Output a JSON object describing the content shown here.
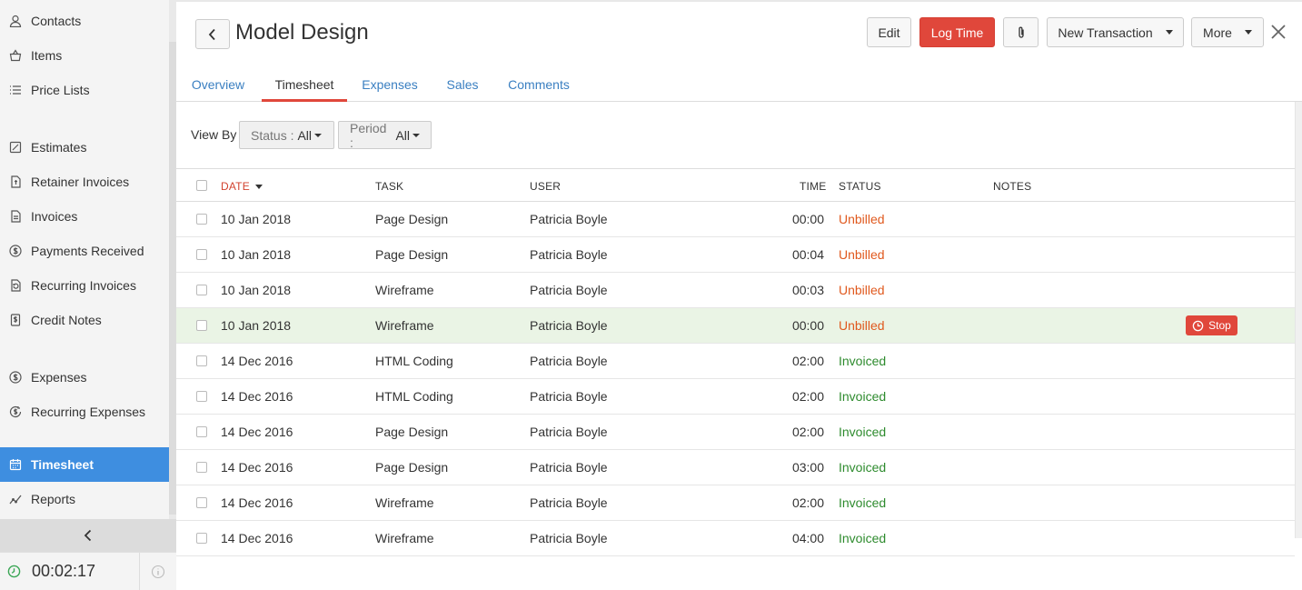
{
  "sidebar": {
    "items": [
      {
        "label": "Contacts",
        "icon": "contacts-icon"
      },
      {
        "label": "Items",
        "icon": "items-icon"
      },
      {
        "label": "Price Lists",
        "icon": "price-lists-icon"
      },
      {
        "label": "Estimates",
        "icon": "estimates-icon"
      },
      {
        "label": "Retainer Invoices",
        "icon": "retainer-invoices-icon"
      },
      {
        "label": "Invoices",
        "icon": "invoices-icon"
      },
      {
        "label": "Payments Received",
        "icon": "payments-received-icon"
      },
      {
        "label": "Recurring Invoices",
        "icon": "recurring-invoices-icon"
      },
      {
        "label": "Credit Notes",
        "icon": "credit-notes-icon"
      },
      {
        "label": "Expenses",
        "icon": "expenses-icon"
      },
      {
        "label": "Recurring Expenses",
        "icon": "recurring-expenses-icon"
      },
      {
        "label": "Timesheet",
        "icon": "timesheet-icon",
        "active": true
      },
      {
        "label": "Reports",
        "icon": "reports-icon"
      }
    ],
    "timer": "00:02:17"
  },
  "header": {
    "title": "Model Design",
    "edit_label": "Edit",
    "log_time_label": "Log Time",
    "new_transaction_label": "New Transaction",
    "more_label": "More"
  },
  "tabs": [
    {
      "label": "Overview"
    },
    {
      "label": "Timesheet",
      "active": true
    },
    {
      "label": "Expenses"
    },
    {
      "label": "Sales"
    },
    {
      "label": "Comments"
    }
  ],
  "filters": {
    "view_by_label": "View By",
    "status_label": "Status :",
    "status_value": "All",
    "period_label": "Period :",
    "period_value": "All"
  },
  "table": {
    "columns": {
      "date": "DATE",
      "task": "TASK",
      "user": "USER",
      "time": "TIME",
      "status": "STATUS",
      "notes": "NOTES"
    },
    "rows": [
      {
        "date": "10 Jan 2018",
        "task": "Page Design",
        "user": "Patricia Boyle",
        "time": "00:00",
        "status": "Unbilled"
      },
      {
        "date": "10 Jan 2018",
        "task": "Page Design",
        "user": "Patricia Boyle",
        "time": "00:04",
        "status": "Unbilled"
      },
      {
        "date": "10 Jan 2018",
        "task": "Wireframe",
        "user": "Patricia Boyle",
        "time": "00:03",
        "status": "Unbilled"
      },
      {
        "date": "10 Jan 2018",
        "task": "Wireframe",
        "user": "Patricia Boyle",
        "time": "00:00",
        "status": "Unbilled"
      },
      {
        "date": "14 Dec 2016",
        "task": "HTML Coding",
        "user": "Patricia Boyle",
        "time": "02:00",
        "status": "Invoiced"
      },
      {
        "date": "14 Dec 2016",
        "task": "HTML Coding",
        "user": "Patricia Boyle",
        "time": "02:00",
        "status": "Invoiced"
      },
      {
        "date": "14 Dec 2016",
        "task": "Page Design",
        "user": "Patricia Boyle",
        "time": "02:00",
        "status": "Invoiced"
      },
      {
        "date": "14 Dec 2016",
        "task": "Page Design",
        "user": "Patricia Boyle",
        "time": "03:00",
        "status": "Invoiced"
      },
      {
        "date": "14 Dec 2016",
        "task": "Wireframe",
        "user": "Patricia Boyle",
        "time": "02:00",
        "status": "Invoiced"
      },
      {
        "date": "14 Dec 2016",
        "task": "Wireframe",
        "user": "Patricia Boyle",
        "time": "04:00",
        "status": "Invoiced"
      }
    ],
    "stop_label": "Stop"
  },
  "colors": {
    "accent_red": "#e0473b",
    "sidebar_active": "#3e8ee0",
    "link_blue": "#3a7fc1",
    "unbilled": "#e0591e",
    "invoiced": "#2e8b2e",
    "highlight_row": "#eaf4e5"
  }
}
